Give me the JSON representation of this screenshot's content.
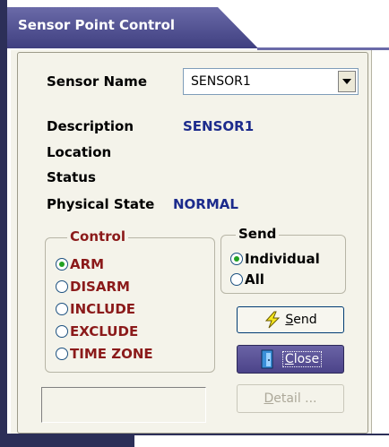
{
  "window": {
    "title": "Sensor Point Control"
  },
  "sensor_name": {
    "label": "Sensor Name",
    "value": "SENSOR1"
  },
  "description": {
    "label": "Description",
    "value": "SENSOR1"
  },
  "location": {
    "label": "Location",
    "value": ""
  },
  "status": {
    "label": "Status",
    "value": ""
  },
  "physical_state": {
    "label": "Physical State",
    "value": "NORMAL"
  },
  "control": {
    "title": "Control",
    "options": [
      "ARM",
      "DISARM",
      "INCLUDE",
      "EXCLUDE",
      "TIME ZONE"
    ],
    "selected": "ARM"
  },
  "send_group": {
    "title": "Send",
    "options": [
      "Individual",
      "All"
    ],
    "selected": "Individual"
  },
  "buttons": {
    "send_prefix": "",
    "send_underlined": "S",
    "send_rest": "end",
    "close_underlined": "C",
    "close_rest": "lose",
    "detail_underlined": "D",
    "detail_rest": "etail ..."
  },
  "colors": {
    "title_bar": "#4f4f93",
    "value_text": "#1c2b8c",
    "control_text": "#8b1a1a",
    "panel_bg": "#f4f3ea"
  },
  "icons": {
    "send": "lightning-icon",
    "close": "door-exit-icon",
    "dropdown": "chevron-down-icon"
  }
}
